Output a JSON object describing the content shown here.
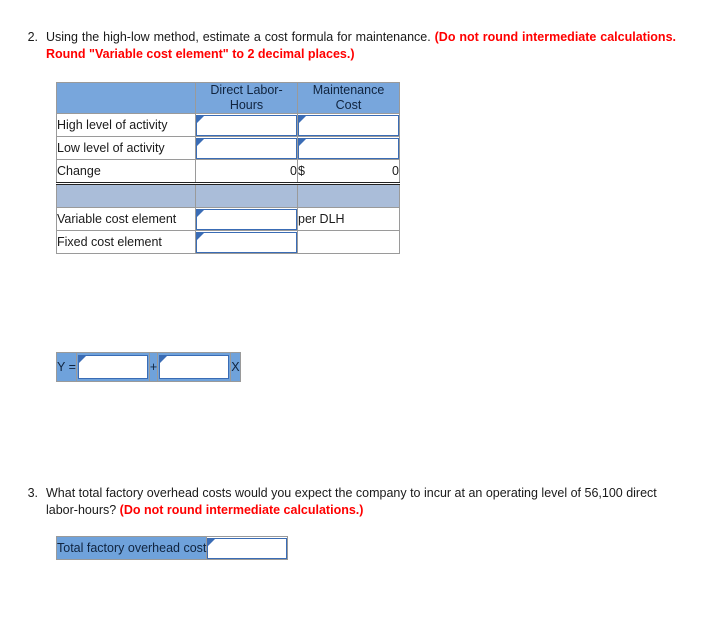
{
  "questions": [
    {
      "number": "2.",
      "text_before": "Using the high-low method, estimate a cost formula for maintenance. ",
      "text_red": "(Do not round intermediate calculations. Round \"Variable cost element\" to 2 decimal places.)"
    },
    {
      "number": "3.",
      "text_before": "What total factory overhead costs would you expect the company to incur at an operating level of 56,100 direct labor-hours? ",
      "text_red": "(Do not round intermediate calculations.)"
    }
  ],
  "highlow_table": {
    "headers": {
      "blank": "",
      "col1_line1": "Direct Labor-",
      "col1_line2": "Hours",
      "col2_line1": "Maintenance",
      "col2_line2": "Cost"
    },
    "rows": [
      {
        "label": "High level of activity",
        "dlh": "",
        "cost": "",
        "type": "input"
      },
      {
        "label": "Low level of activity",
        "dlh": "",
        "cost": "",
        "type": "input"
      },
      {
        "label": "Change",
        "dlh": "0",
        "cost_symbol": "$",
        "cost": "0",
        "type": "computed"
      }
    ],
    "band": "",
    "result_rows": [
      {
        "label": "Variable cost element",
        "value": "",
        "unit": "per DLH"
      },
      {
        "label": "Fixed cost element",
        "value": "",
        "unit": ""
      }
    ]
  },
  "formula": {
    "y_label": "Y =",
    "variable_value": "",
    "plus": "+",
    "fixed_value": "",
    "x_label": "X"
  },
  "total_table": {
    "label": "Total factory overhead cost",
    "value": ""
  },
  "colors": {
    "header_blue": "#78a6dc",
    "band_blue": "#aabdd9",
    "label_blue": "#6fa2db",
    "input_border": "#3a6cb5",
    "red_text": "#ff0000",
    "grid_line": "#9a9a9a"
  }
}
